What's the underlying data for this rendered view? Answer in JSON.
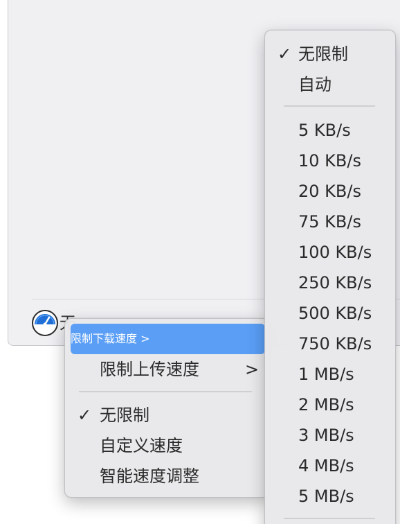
{
  "status_bar": {
    "speed_label": "无"
  },
  "main_menu": {
    "items": [
      {
        "label": "限制下载速度",
        "has_submenu": true,
        "highlighted": true
      },
      {
        "label": "限制上传速度",
        "has_submenu": true
      },
      {
        "label": "无限制",
        "checked": true
      },
      {
        "label": "自定义速度"
      },
      {
        "label": "智能速度调整"
      }
    ],
    "submenu_arrow": ">",
    "check_mark": "✓"
  },
  "download_submenu": {
    "top_items": [
      {
        "label": "无限制",
        "checked": true
      },
      {
        "label": "自动"
      }
    ],
    "speeds": [
      "5 KB/s",
      "10 KB/s",
      "20 KB/s",
      "75 KB/s",
      "100 KB/s",
      "250 KB/s",
      "500 KB/s",
      "750 KB/s",
      "1 MB/s",
      "2 MB/s",
      "3 MB/s",
      "4 MB/s",
      "5 MB/s"
    ]
  },
  "colors": {
    "highlight": "#5a9ef5",
    "icon_blue": "#1f6fd6"
  },
  "icons": {
    "speed": "speedometer-icon",
    "check": "checkmark-icon",
    "submenu": "chevron-right-icon"
  }
}
